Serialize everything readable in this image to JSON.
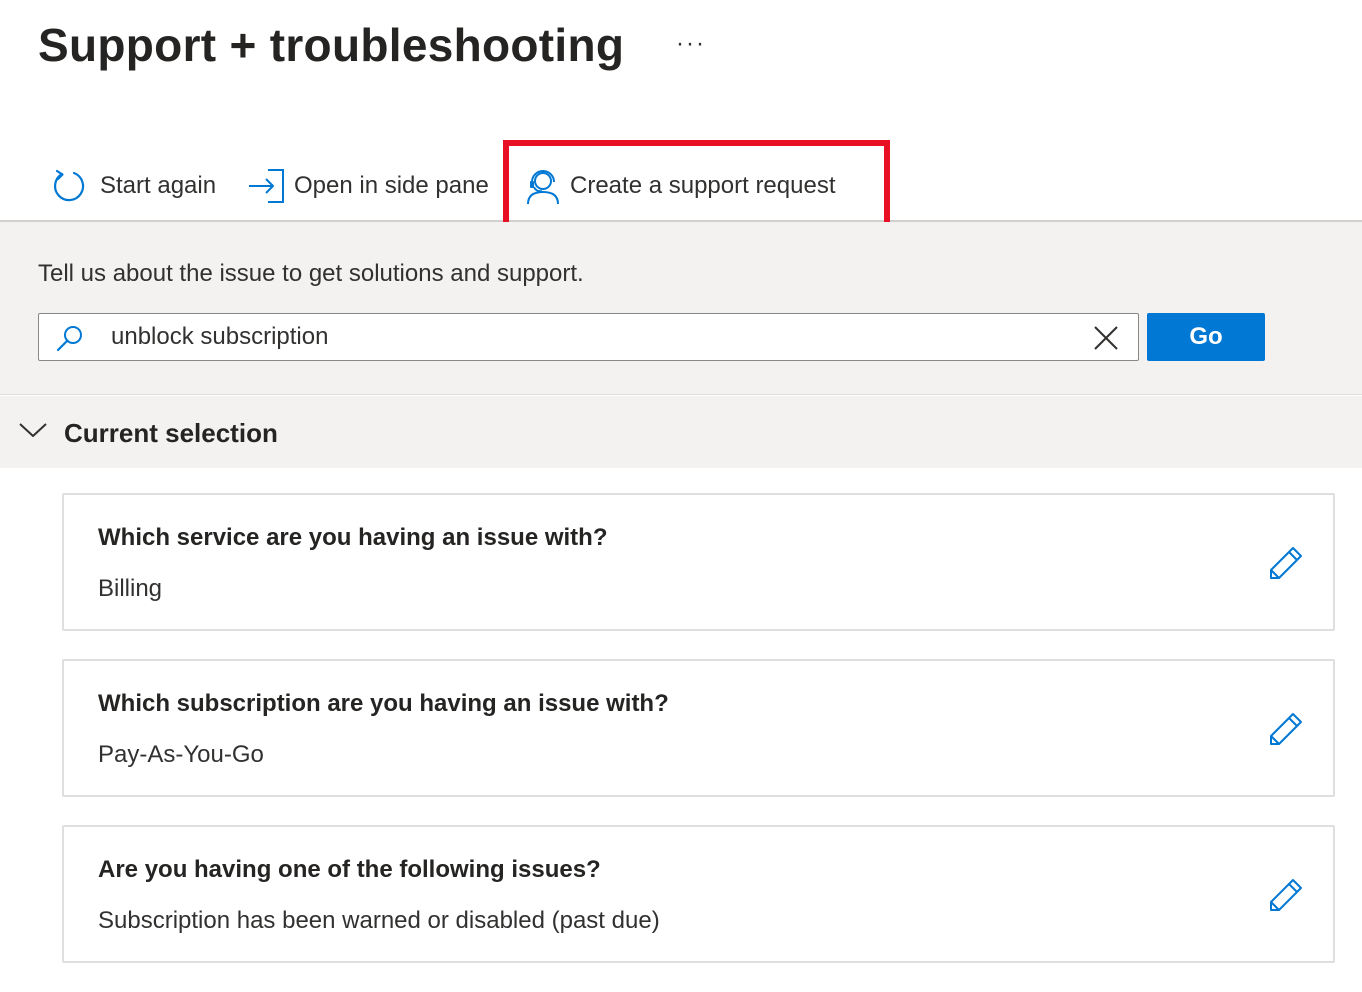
{
  "header": {
    "title": "Support + troubleshooting",
    "more_label": "···"
  },
  "toolbar": {
    "start_again": "Start again",
    "open_side_pane": "Open in side pane",
    "create_request": "Create a support request"
  },
  "search": {
    "prompt": "Tell us about the issue to get solutions and support.",
    "value": "unblock subscription",
    "go_label": "Go"
  },
  "selection": {
    "title": "Current selection",
    "items": [
      {
        "question": "Which service are you having an issue with?",
        "answer": "Billing"
      },
      {
        "question": "Which subscription are you having an issue with?",
        "answer": "Pay-As-You-Go"
      },
      {
        "question": "Are you having one of the following issues?",
        "answer": "Subscription has been warned or disabled (past due)"
      }
    ]
  },
  "colors": {
    "accent": "#0078d4",
    "highlight": "#e81123",
    "panel_bg": "#f3f2f1"
  }
}
